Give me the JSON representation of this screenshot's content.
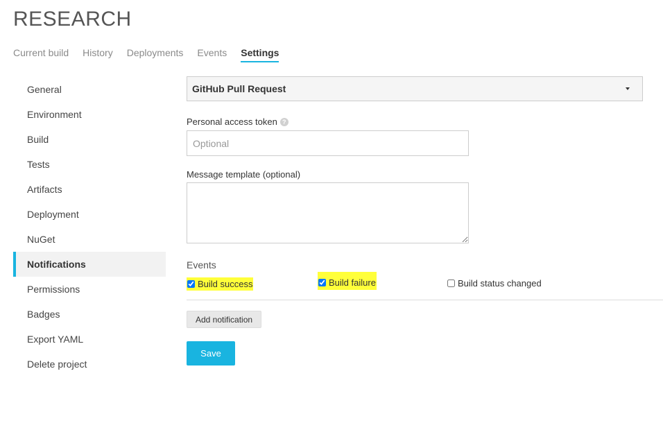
{
  "app": {
    "title": "RESEARCH"
  },
  "tabs": [
    {
      "label": "Current build"
    },
    {
      "label": "History"
    },
    {
      "label": "Deployments"
    },
    {
      "label": "Events"
    },
    {
      "label": "Settings",
      "active": true
    }
  ],
  "sidebar": {
    "items": [
      {
        "label": "General"
      },
      {
        "label": "Environment"
      },
      {
        "label": "Build"
      },
      {
        "label": "Tests"
      },
      {
        "label": "Artifacts"
      },
      {
        "label": "Deployment"
      },
      {
        "label": "NuGet"
      },
      {
        "label": "Notifications",
        "active": true
      },
      {
        "label": "Permissions"
      },
      {
        "label": "Badges"
      },
      {
        "label": "Export YAML"
      },
      {
        "label": "Delete project"
      }
    ]
  },
  "form": {
    "provider": {
      "selected": "GitHub Pull Request"
    },
    "token": {
      "label": "Personal access token",
      "help_icon": "question-icon",
      "placeholder": "Optional",
      "value": ""
    },
    "message": {
      "label": "Message template (optional)",
      "value": ""
    },
    "events": {
      "title": "Events",
      "options": [
        {
          "label": "Build success",
          "checked": true
        },
        {
          "label": "Build failure",
          "checked": true
        },
        {
          "label": "Build status changed",
          "checked": false
        }
      ]
    },
    "add_label": "Add notification",
    "save_label": "Save"
  },
  "colors": {
    "accent": "#19b4e0",
    "highlight": "#ffff3a"
  }
}
